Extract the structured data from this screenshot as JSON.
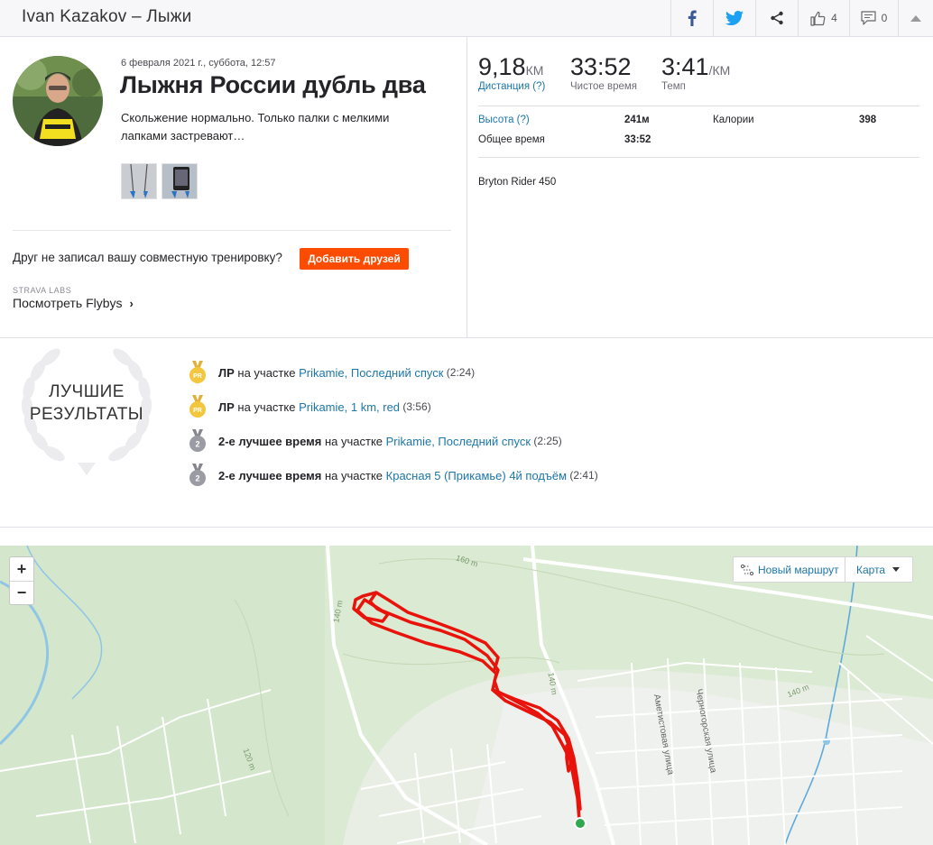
{
  "header": {
    "title": "Ivan Kazakov – Лыжи",
    "kudos_count": "4",
    "comments_count": "0"
  },
  "activity": {
    "date": "6 февраля 2021 г., суббота, 12:57",
    "name": "Лыжня России дубль два",
    "description": "Скольжение нормально. Только палки с мелкими лапками застревают…",
    "friend_prompt": "Друг не записал вашу совместную тренировку?",
    "add_friends_label": "Добавить друзей",
    "labs_label": "STRAVA LABS",
    "flybys_label": "Посмотреть Flybys"
  },
  "stats": {
    "distance": {
      "value": "9,18",
      "unit": "КМ",
      "label": "Дистанция (?)"
    },
    "moving_time": {
      "value": "33:52",
      "label": "Чистое время"
    },
    "pace": {
      "value": "3:41",
      "unit": "/КМ",
      "label": "Темп"
    },
    "elevation_label": "Высота (?)",
    "elevation_value": "241м",
    "calories_label": "Калории",
    "calories_value": "398",
    "elapsed_label": "Общее время",
    "elapsed_value": "33:52",
    "device": "Bryton Rider 450"
  },
  "achievements": {
    "badge_line1": "ЛУЧШИЕ",
    "badge_line2": "РЕЗУЛЬТАТЫ",
    "items": [
      {
        "medal": "PR",
        "kind": "ЛР",
        "middle": " на участке ",
        "segment": "Prikamie, Последний спуск",
        "time": " (2:24)"
      },
      {
        "medal": "PR",
        "kind": "ЛР",
        "middle": " на участке ",
        "segment": "Prikamie, 1 km, red",
        "time": " (3:56)"
      },
      {
        "medal": "2",
        "kind": "2-е лучшее время",
        "middle": " на участке ",
        "segment": "Prikamie, Последний спуск",
        "time": " (2:25)"
      },
      {
        "medal": "2",
        "kind": "2-е лучшее время",
        "middle": " на участке ",
        "segment": "Красная 5 (Прикамье) 4й подъём",
        "time": " (2:41)"
      }
    ]
  },
  "map": {
    "zoom_in": "+",
    "zoom_out": "−",
    "new_route": "Новый маршрут",
    "map_type": "Карта",
    "contour_labels": [
      "160 m",
      "140 m",
      "140 m",
      "140 m",
      "120 m"
    ],
    "street_labels": [
      "Аметистовая улица",
      "Черногорская улица"
    ]
  },
  "colors": {
    "brand": "#fc4c02",
    "link": "#1d76a8",
    "route": "#e8130b",
    "pr_medal": "#f2c63d",
    "silver_medal": "#9b9ba3"
  }
}
